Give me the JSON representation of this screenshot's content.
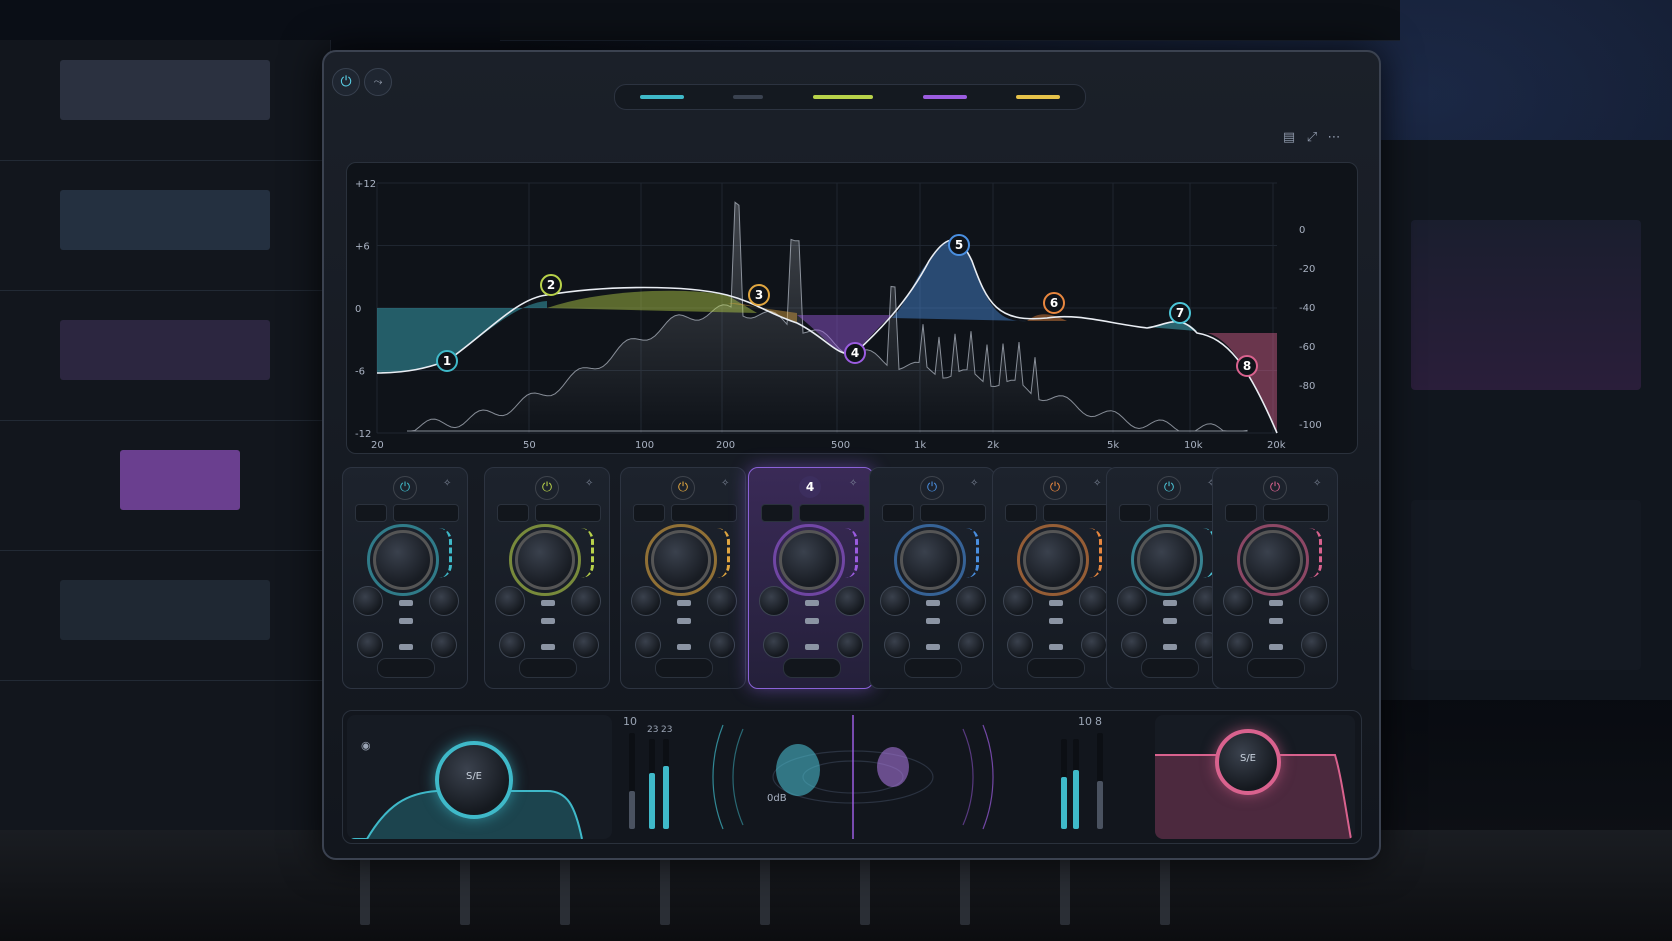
{
  "eq_graph": {
    "db_ticks": [
      "+12",
      "+6",
      "0",
      "-6",
      "-12"
    ],
    "freq_ticks": [
      "20",
      "50",
      "100",
      "200",
      "500",
      "1k",
      "2k",
      "5k",
      "10k",
      "20k"
    ],
    "right_scale": [
      "0",
      "-20",
      "-40",
      "-60",
      "-80",
      "-100"
    ],
    "nodes": [
      {
        "label": "1",
        "color": "#3fb9c9"
      },
      {
        "label": "2",
        "color": "#b8d24a"
      },
      {
        "label": "3",
        "color": "#e0a640"
      },
      {
        "label": "4",
        "color": "#9b5ce0"
      },
      {
        "label": "5",
        "color": "#4a8fe0"
      },
      {
        "label": "6",
        "color": "#e8873f"
      },
      {
        "label": "7",
        "color": "#4cc6d8"
      },
      {
        "label": "8",
        "color": "#d9628e"
      }
    ]
  },
  "bands": [
    {
      "color": "#3fb9c9",
      "icon": "power-icon"
    },
    {
      "color": "#b8d24a",
      "icon": "power-icon"
    },
    {
      "color": "#e0a640",
      "icon": "power-icon"
    },
    {
      "color": "#9b5ce0",
      "label": "4",
      "active": true
    },
    {
      "color": "#4a8fe0",
      "icon": "power-icon"
    },
    {
      "color": "#e8873f",
      "icon": "power-icon"
    },
    {
      "color": "#4cc6d8",
      "icon": "power-icon"
    },
    {
      "color": "#d9628e",
      "icon": "power-icon"
    }
  ],
  "bottom": {
    "left_meter_top_label": "10",
    "right_meter_top_label": "10",
    "right_meter_label_b": "8",
    "meter_labels": [
      "23",
      "23"
    ],
    "stereo_center_label": "0dB"
  },
  "colors": {
    "accent_cyan": "#3fb9c9",
    "accent_purple": "#9b5ce0",
    "accent_pink": "#d9628e",
    "accent_yellow": "#e6c24a"
  }
}
